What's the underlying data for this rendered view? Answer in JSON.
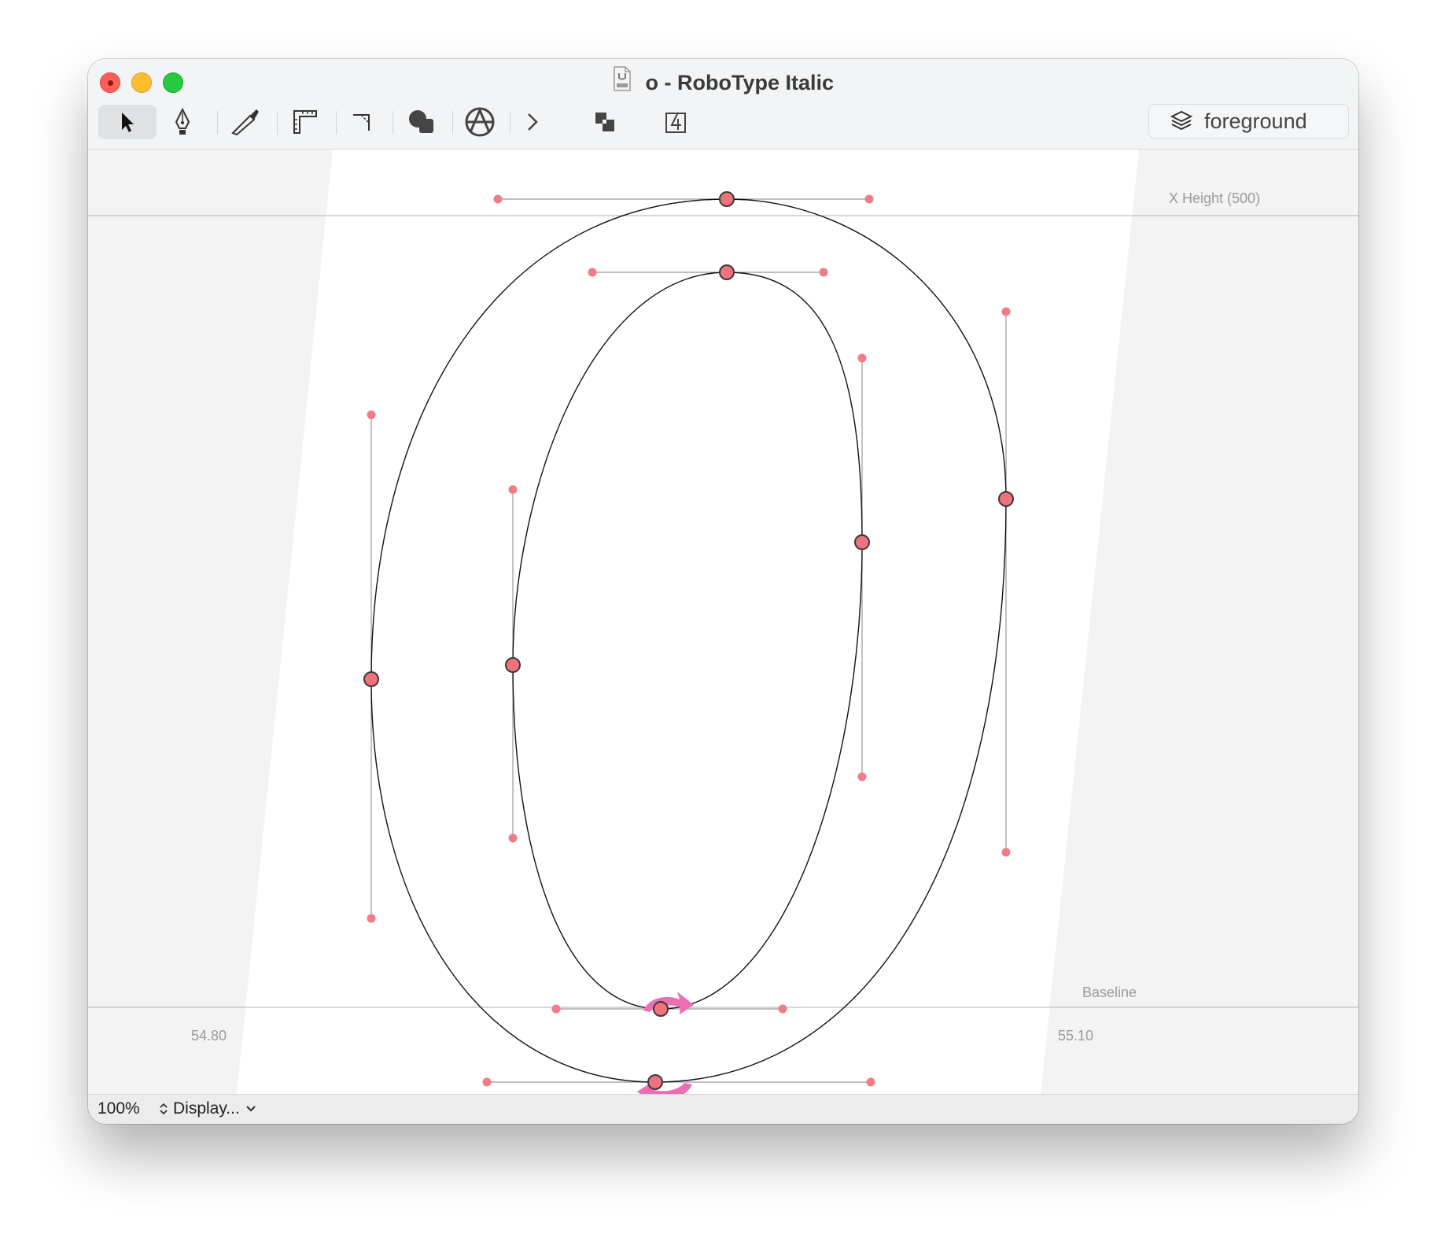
{
  "window": {
    "title": "o - RoboType Italic",
    "doc_icon": "ufo-file-icon"
  },
  "toolbar": {
    "tools": [
      {
        "name": "select-tool",
        "icon": "arrow-pointer-icon",
        "active": true
      },
      {
        "name": "pen-tool",
        "icon": "pen-nib-icon"
      },
      {
        "name": "knife-tool",
        "icon": "knife-icon"
      },
      {
        "name": "measure-tool",
        "icon": "ruler-icon"
      },
      {
        "name": "corner-tool",
        "icon": "corner-icon"
      },
      {
        "name": "shapes-tool",
        "icon": "shapes-icon"
      },
      {
        "name": "anchor-tool",
        "icon": "circle-a-icon"
      },
      {
        "name": "more-tools",
        "icon": "chevron-right-icon"
      },
      {
        "name": "layers-overlap-button",
        "icon": "overlap-squares-icon"
      },
      {
        "name": "component-button",
        "icon": "square-4-icon"
      }
    ],
    "layer": {
      "label": "foreground",
      "icon": "layers-stack-icon"
    }
  },
  "canvas": {
    "guides": {
      "xheight_label": "X Height (500)",
      "baseline_label": "Baseline"
    },
    "margins": {
      "left": "54.80",
      "right": "55.10"
    },
    "point_color": "#f0727c",
    "handle_color": "#f07c88",
    "start_arrow_color": "#ec6fb4"
  },
  "status": {
    "zoom": "100%",
    "display_label": "Display..."
  }
}
